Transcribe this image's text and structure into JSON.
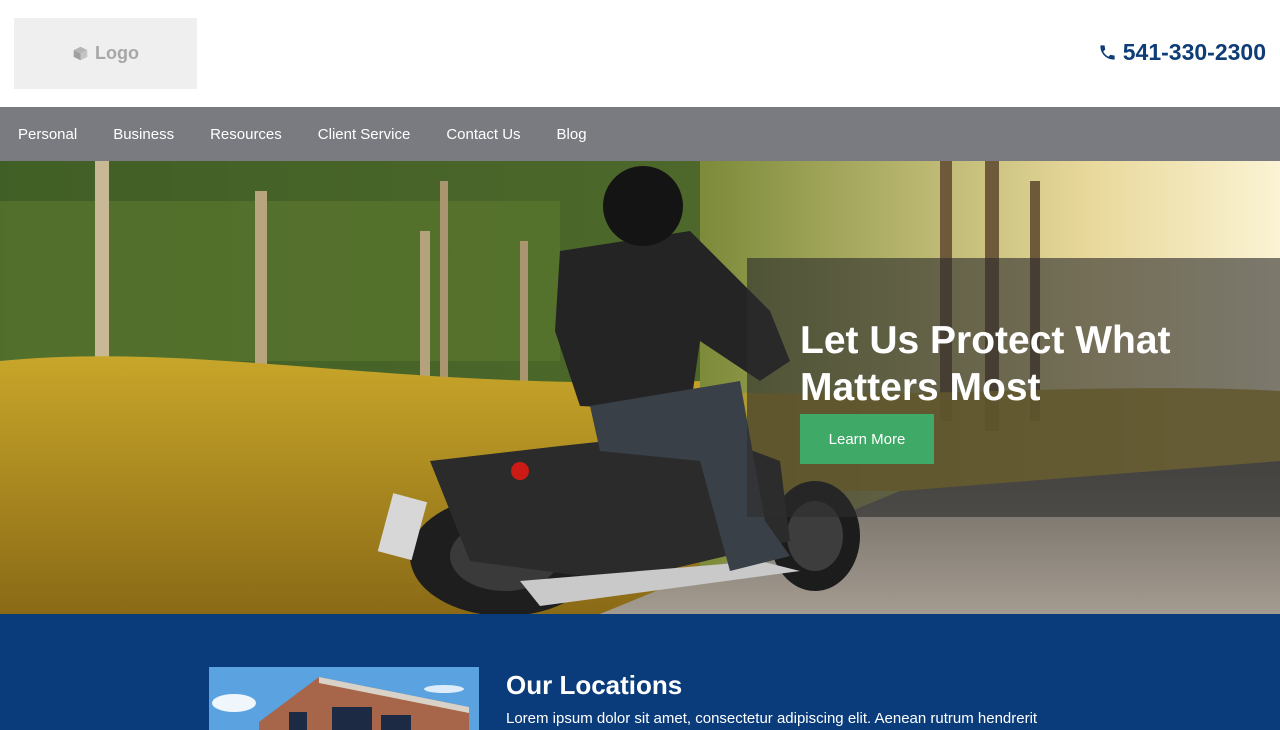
{
  "header": {
    "logo_text": "Logo",
    "logo_icon": "cube-icon",
    "phone_icon": "phone-icon",
    "phone": "541-330-2300"
  },
  "nav": {
    "items": [
      "Personal",
      "Business",
      "Resources",
      "Client Service",
      "Contact Us",
      "Blog"
    ]
  },
  "hero": {
    "title": "Let Us Protect What Matters Most",
    "button_label": "Learn More"
  },
  "locations": {
    "title": "Our Locations",
    "text": "Lorem ipsum dolor sit amet, consectetur adipiscing elit. Aenean rutrum hendrerit"
  },
  "colors": {
    "nav_bg": "#7a7b80",
    "phone": "#0f3d77",
    "button": "#3faa68",
    "locations_bg": "#0a3c7c"
  }
}
